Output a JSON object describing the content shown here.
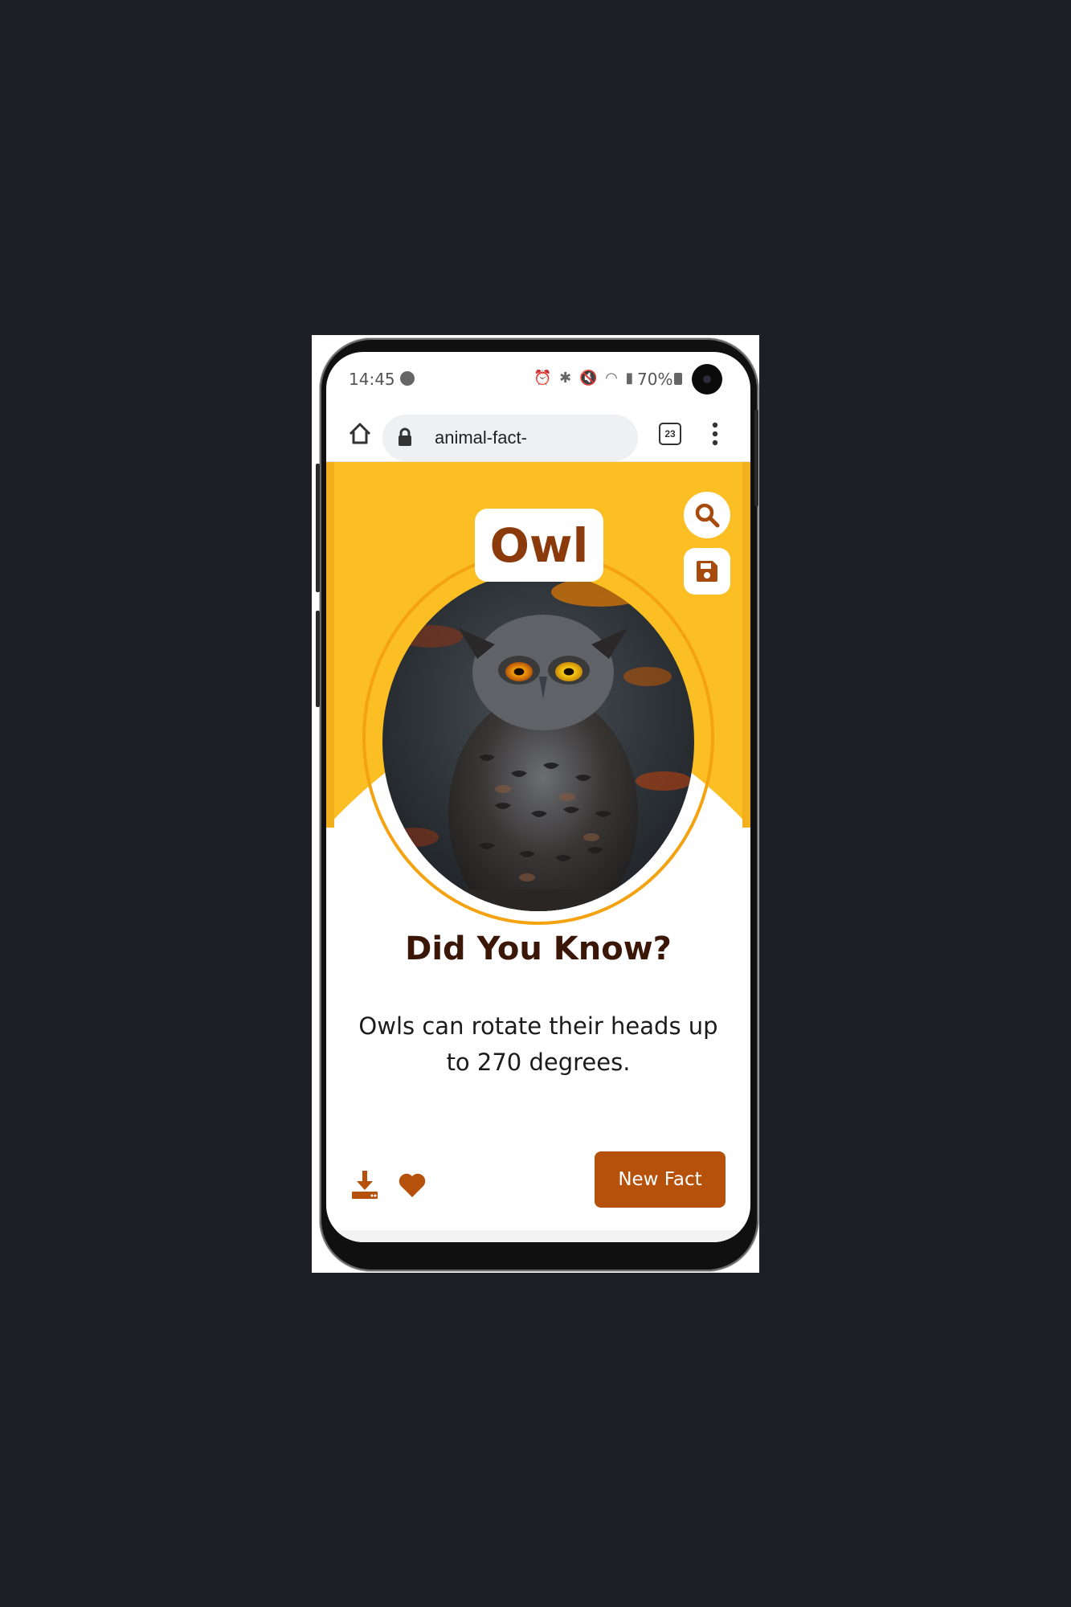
{
  "status_bar": {
    "time": "14:45",
    "battery": "70%"
  },
  "browser": {
    "url": "animal-fact-",
    "tab_count": "23"
  },
  "animal": {
    "name": "Owl"
  },
  "fact_card": {
    "headline": "Did You Know?",
    "fact_text": "Owls can rotate their heads up to 270 degrees."
  },
  "actions": {
    "new_fact_label": "New Fact"
  },
  "colors": {
    "hero_yellow": "#fbbf24",
    "ring_orange": "#f4a20f",
    "brand_brown": "#8b3a0b",
    "button_brown": "#b5510b",
    "headline_dark": "#3b1708",
    "page_background": "#1e1f24"
  },
  "icons": [
    "home-icon",
    "lock-icon",
    "tabs-icon",
    "menu-icon",
    "search-icon",
    "save-icon",
    "download-icon",
    "heart-icon"
  ]
}
